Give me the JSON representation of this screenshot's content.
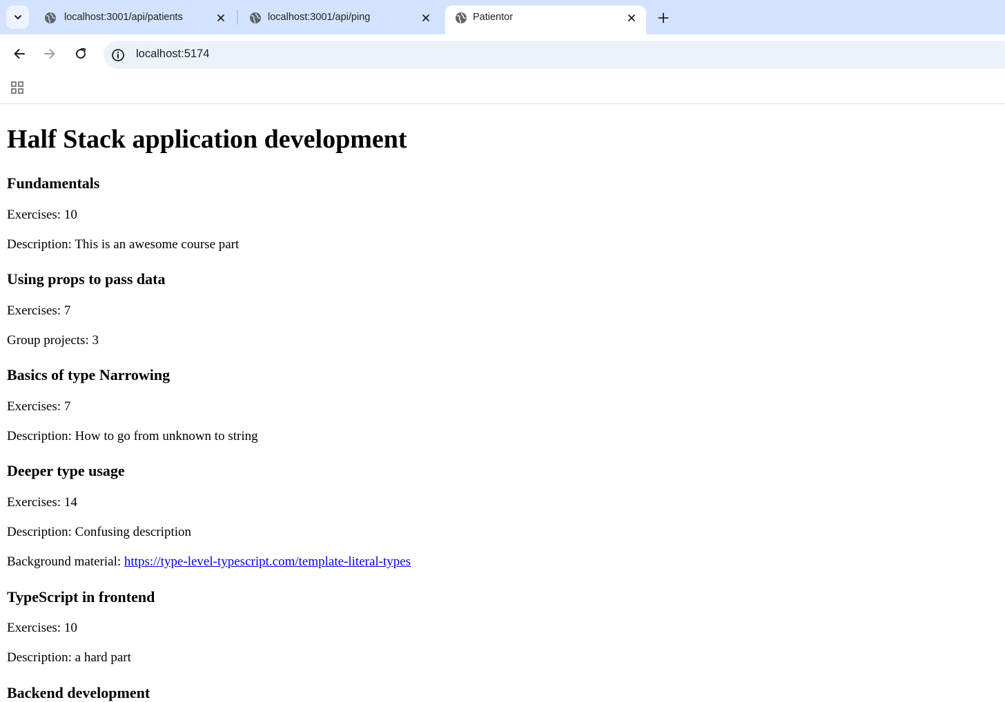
{
  "browser": {
    "tabs": [
      {
        "title": "localhost:3001/api/patients",
        "active": false
      },
      {
        "title": "localhost:3001/api/ping",
        "active": false
      },
      {
        "title": "Patientor",
        "active": true
      }
    ],
    "url": "localhost:5174",
    "icons": {
      "tab_search": "chevron-down-icon",
      "tab_favicon": "globe-icon",
      "tab_close": "close-icon",
      "new_tab": "plus-icon",
      "back": "arrow-left-icon",
      "forward": "arrow-right-icon",
      "reload": "reload-icon",
      "site_info": "info-icon",
      "apps": "apps-grid-icon"
    },
    "colors": {
      "tabstrip": "#d3e3fd",
      "omnibox": "#edf2fa",
      "link": "#0000ee"
    }
  },
  "page": {
    "heading": "Half Stack application development",
    "parts": [
      {
        "name": "Fundamentals",
        "exercises": "Exercises: 10",
        "description": "Description: This is an awesome course part"
      },
      {
        "name": "Using props to pass data",
        "exercises": "Exercises: 7",
        "group": "Group projects: 3"
      },
      {
        "name": "Basics of type Narrowing",
        "exercises": "Exercises: 7",
        "description": "Description: How to go from unknown to string"
      },
      {
        "name": "Deeper type usage",
        "exercises": "Exercises: 14",
        "description": "Description: Confusing description",
        "background_label": "Background material: ",
        "background_link": "https://type-level-typescript.com/template-literal-types"
      },
      {
        "name": "TypeScript in frontend",
        "exercises": "Exercises: 10",
        "description": "Description: a hard part"
      },
      {
        "name": "Backend development"
      }
    ]
  }
}
